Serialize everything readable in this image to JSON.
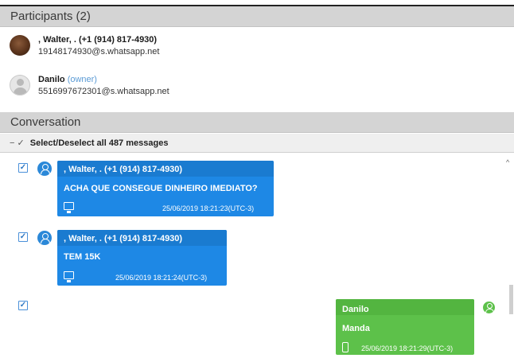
{
  "participants": {
    "title": "Participants (2)",
    "items": [
      {
        "name": ", Walter, . (+1 (914) 817-4930)",
        "jid": "19148174930@s.whatsapp.net",
        "owner_label": ""
      },
      {
        "name": "Danilo",
        "owner_label": "(owner)",
        "jid": "5516997672301@s.whatsapp.net"
      }
    ]
  },
  "conversation": {
    "title": "Conversation",
    "select_icons": "− ✓",
    "select_all_label": "Select/Deselect all 487 messages",
    "messages": [
      {
        "checked": true,
        "sender": ", Walter, . (+1 (914) 817-4930)",
        "text": "ACHA QUE CONSEGUE DINHEIRO IMEDIATO?",
        "timestamp": "25/06/2019 18:21:23(UTC-3)",
        "device": "desktop-icon",
        "direction": "incoming",
        "color": "#1e88e5"
      },
      {
        "checked": true,
        "sender": ", Walter, . (+1 (914) 817-4930)",
        "text": "TEM 15K",
        "timestamp": "25/06/2019 18:21:24(UTC-3)",
        "device": "desktop-icon",
        "direction": "incoming",
        "color": "#1e88e5"
      },
      {
        "checked": true,
        "sender": "Danilo",
        "text": "Manda",
        "timestamp": "25/06/2019 18:21:29(UTC-3)",
        "device": "phone-icon",
        "direction": "outgoing",
        "color": "#5dc14a"
      }
    ]
  },
  "checkbox_mark": "✓",
  "scroll_up_glyph": "^"
}
